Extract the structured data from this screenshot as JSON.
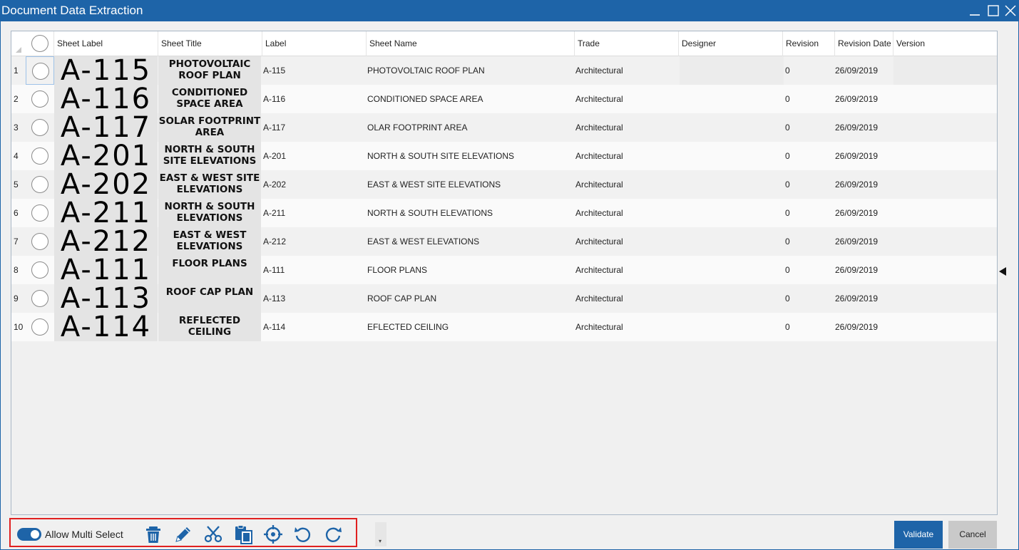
{
  "window": {
    "title": "Document Data Extraction"
  },
  "grid": {
    "columns": [
      "Sheet Label",
      "Sheet Title",
      "Label",
      "Sheet Name",
      "Trade",
      "Designer",
      "Revision",
      "Revision Date",
      "Version"
    ],
    "rows": [
      {
        "num": "1",
        "sheet_label": "A-115",
        "sheet_title": "PHOTOVOLTAIC ROOF PLAN",
        "label": "A-115",
        "sheet_name": "PHOTOVOLTAIC  ROOF PLAN",
        "trade": "Architectural",
        "designer": "",
        "revision": "0",
        "revision_date": "26/09/2019",
        "version": ""
      },
      {
        "num": "2",
        "sheet_label": "A-116",
        "sheet_title": "CONDITIONED SPACE AREA",
        "label": "A-116",
        "sheet_name": "CONDITIONED  SPACE AREA",
        "trade": "Architectural",
        "designer": "",
        "revision": "0",
        "revision_date": "26/09/2019",
        "version": ""
      },
      {
        "num": "3",
        "sheet_label": "A-117",
        "sheet_title": "SOLAR FOOTPRINT AREA",
        "label": "A-117",
        "sheet_name": "OLAR FOOTPRINT  AREA",
        "trade": "Architectural",
        "designer": "",
        "revision": "0",
        "revision_date": "26/09/2019",
        "version": ""
      },
      {
        "num": "4",
        "sheet_label": "A-201",
        "sheet_title": "NORTH & SOUTH SITE ELEVATIONS",
        "label": "A-201",
        "sheet_name": "NORTH & SOUTH  SITE ELEVATIONS",
        "trade": "Architectural",
        "designer": "",
        "revision": "0",
        "revision_date": "26/09/2019",
        "version": ""
      },
      {
        "num": "5",
        "sheet_label": "A-202",
        "sheet_title": "EAST & WEST SITE ELEVATIONS",
        "label": "A-202",
        "sheet_name": "EAST & WEST SITE  ELEVATIONS",
        "trade": "Architectural",
        "designer": "",
        "revision": "0",
        "revision_date": "26/09/2019",
        "version": ""
      },
      {
        "num": "6",
        "sheet_label": "A-211",
        "sheet_title": "NORTH & SOUTH ELEVATIONS",
        "label": "A-211",
        "sheet_name": "NORTH & SOUTH  ELEVATIONS",
        "trade": "Architectural",
        "designer": "",
        "revision": "0",
        "revision_date": "26/09/2019",
        "version": ""
      },
      {
        "num": "7",
        "sheet_label": "A-212",
        "sheet_title": "EAST & WEST ELEVATIONS",
        "label": "A-212",
        "sheet_name": "EAST & WEST  ELEVATIONS",
        "trade": "Architectural",
        "designer": "",
        "revision": "0",
        "revision_date": "26/09/2019",
        "version": ""
      },
      {
        "num": "8",
        "sheet_label": "A-111",
        "sheet_title": "FLOOR PLANS",
        "label": "A-111",
        "sheet_name": "FLOOR PLANS",
        "trade": "Architectural",
        "designer": "",
        "revision": "0",
        "revision_date": "26/09/2019",
        "version": ""
      },
      {
        "num": "9",
        "sheet_label": "A-113",
        "sheet_title": "ROOF CAP PLAN",
        "label": "A-113",
        "sheet_name": "ROOF CAP PLAN",
        "trade": "Architectural",
        "designer": "",
        "revision": "0",
        "revision_date": "26/09/2019",
        "version": ""
      },
      {
        "num": "10",
        "sheet_label": "A-114",
        "sheet_title": "REFLECTED CEILING",
        "label": "A-114",
        "sheet_name": "EFLECTED CEILING",
        "trade": "Architectural",
        "designer": "",
        "revision": "0",
        "revision_date": "26/09/2019",
        "version": ""
      }
    ]
  },
  "toolbar": {
    "multi_select_label": "Allow Multi Select",
    "multi_select_on": true,
    "tools": [
      "trash-icon",
      "pencil-icon",
      "scissors-icon",
      "copy-paste-icon",
      "crosshair-icon",
      "undo-icon",
      "redo-icon"
    ]
  },
  "actions": {
    "validate_label": "Validate",
    "cancel_label": "Cancel"
  },
  "colors": {
    "accent": "#1e64a8",
    "highlight_border": "#e02020"
  }
}
